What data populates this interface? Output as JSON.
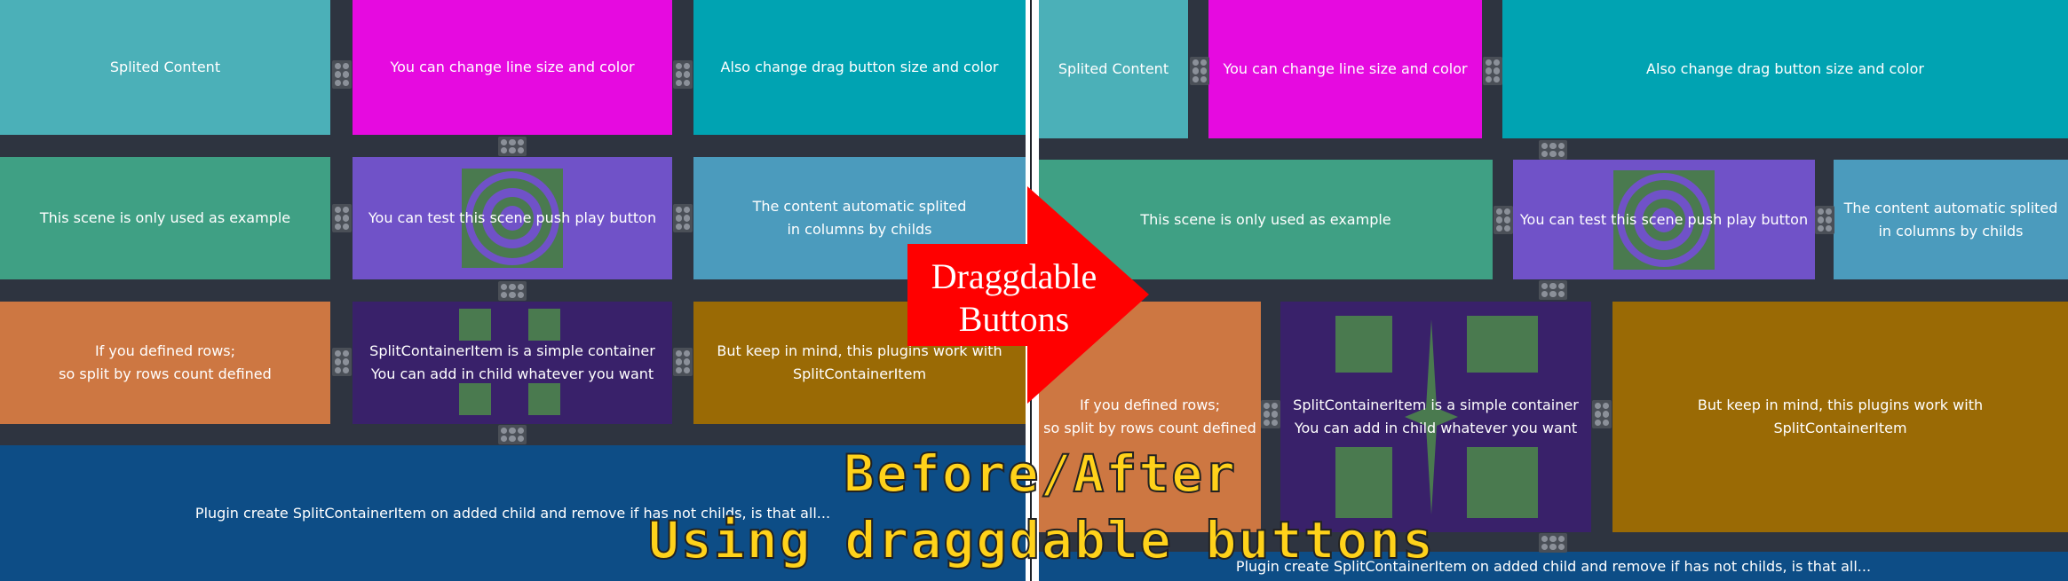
{
  "colors": {
    "background": "#2e3440",
    "teal_light": "#4bb0b8",
    "magenta": "#e60ae0",
    "teal": "#00a3b2",
    "green": "#3fa084",
    "purple": "#7052c8",
    "steel_blue": "#4b9bbd",
    "orange": "#cd7742",
    "dark_purple": "#39216a",
    "gold": "#9a6a05",
    "navy": "#0d4d86",
    "accent_red": "#ff0000",
    "caption_yellow": "#ffd21a",
    "decoration_green": "#4a7a4f"
  },
  "cells": {
    "splited": "Splited Content",
    "line": "You can change line size and color",
    "drag": "Also change drag button size and color",
    "scene": "This scene is only used as example",
    "test": "You can test this scene push play button",
    "auto_line1": "The content automatic splited",
    "auto_line2": "in columns by childs",
    "rows_line1": "If you defined rows;",
    "rows_line2": "so split by rows count defined",
    "item_line1": "SplitContainerItem is a simple container",
    "item_line2": "You can add in child whatever you want",
    "keep_line1": "But keep in mind, this plugins work with",
    "keep_line2": "SplitContainerItem",
    "plugin": "Plugin create SplitContainerItem on added child and remove if has not childs, is that all..."
  },
  "arrow": {
    "line1": "Draggdable",
    "line2": "Buttons"
  },
  "caption": {
    "line1": "Before/After",
    "line2": "Using draggdable buttons"
  },
  "icons": {
    "drag_handle": "grip-dots-icon",
    "target": "concentric-circles-icon",
    "squares": "four-squares-icon"
  }
}
